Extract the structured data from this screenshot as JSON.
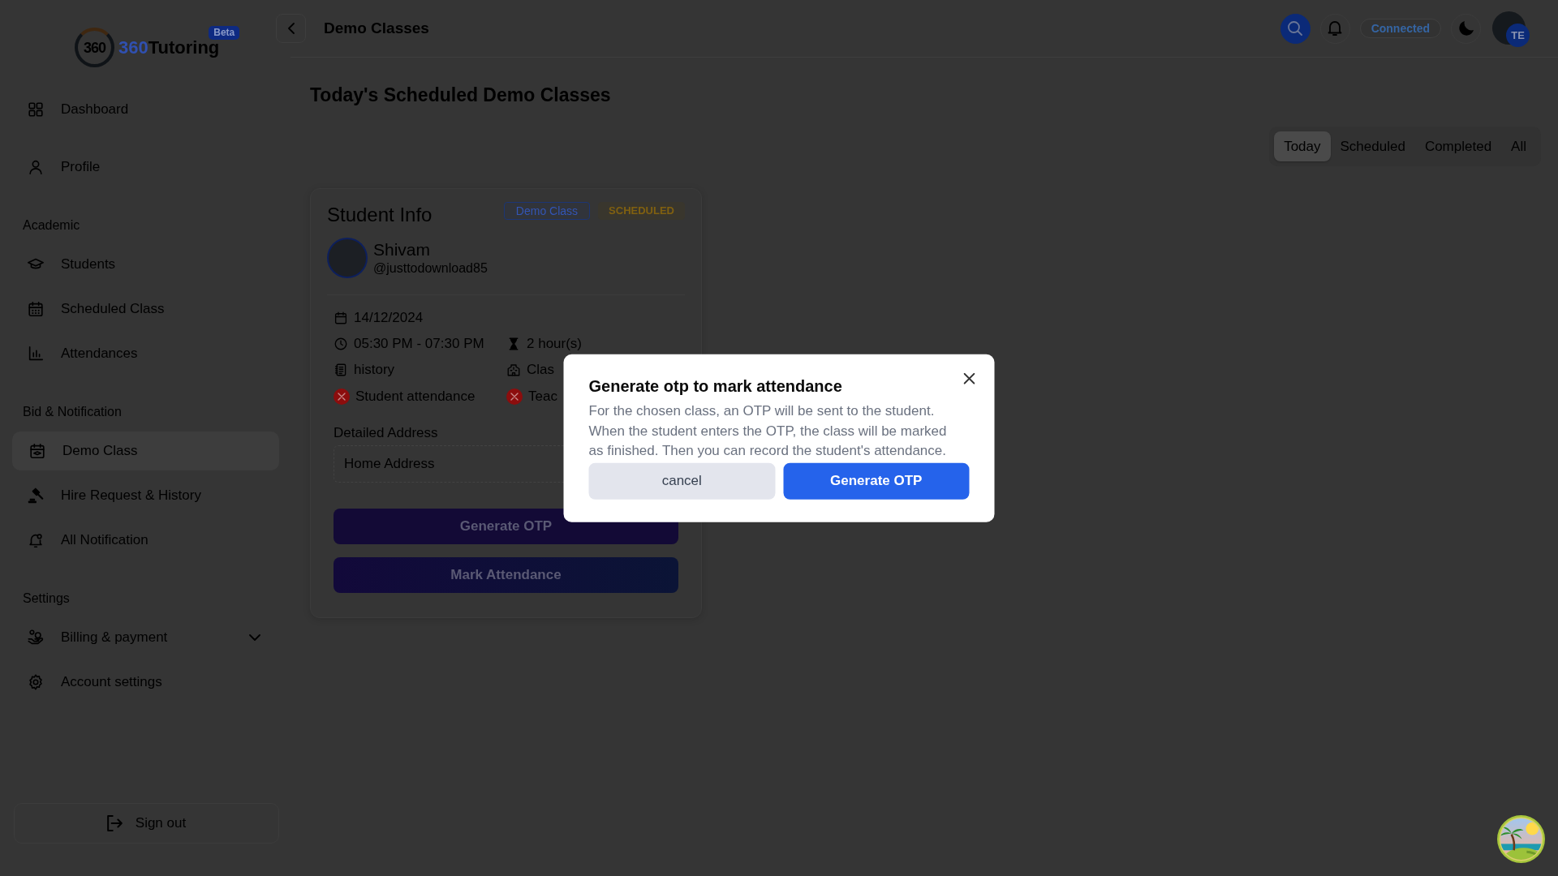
{
  "sidebar": {
    "logo": {
      "emblem": "360",
      "accent": "360",
      "name": "Tutoring",
      "badge": "Beta"
    },
    "sections": [
      {
        "items": [
          {
            "label": "Dashboard",
            "selected": false,
            "kind": "link"
          },
          {
            "label": "Profile",
            "selected": false,
            "kind": "link"
          }
        ]
      },
      {
        "title": "Academic",
        "items": [
          {
            "label": "Students",
            "selected": false,
            "kind": "link"
          },
          {
            "label": "Scheduled Class",
            "selected": false,
            "kind": "link"
          },
          {
            "label": "Attendances",
            "selected": false,
            "kind": "link"
          }
        ]
      },
      {
        "title": "Bid & Notification",
        "items": [
          {
            "label": "Demo Class",
            "selected": true,
            "kind": "link"
          },
          {
            "label": "Hire Request & History",
            "selected": false,
            "kind": "link"
          },
          {
            "label": "All Notification",
            "selected": false,
            "kind": "link"
          }
        ]
      },
      {
        "title": "Settings",
        "items": [
          {
            "label": "Billing & payment",
            "selected": false,
            "kind": "group",
            "expanded": false
          },
          {
            "label": "Account settings",
            "selected": false,
            "kind": "link"
          }
        ]
      }
    ],
    "sign_out": "Sign out"
  },
  "header": {
    "title": "Demo Classes",
    "connection": "Connected",
    "initials": "TE"
  },
  "page": {
    "title": "Today's Scheduled Demo Classes",
    "tabs": [
      {
        "label": "Today",
        "selected": true
      },
      {
        "label": "Scheduled",
        "selected": false
      },
      {
        "label": "Completed",
        "selected": false
      },
      {
        "label": "All",
        "selected": false
      }
    ]
  },
  "card": {
    "title": "Student Info",
    "badges": [
      {
        "label": "Demo Class",
        "kind": "type"
      },
      {
        "label": "SCHEDULED",
        "kind": "status"
      }
    ],
    "student": {
      "name": "Shivam",
      "handle": "@justtodownload85"
    },
    "detail_rows": [
      [
        "14/12/2024"
      ],
      [
        "05:30 PM - 07:30 PM",
        "2 hour(s)"
      ],
      [
        "history",
        "Clas"
      ]
    ],
    "attendance": [
      {
        "label": "Student attendance",
        "marked": false
      },
      {
        "label": "Teac",
        "marked": false
      }
    ],
    "address": {
      "label": "Detailed Address",
      "value": "Home Address"
    },
    "buttons": [
      {
        "label": "Generate OTP"
      },
      {
        "label": "Mark Attendance"
      }
    ]
  },
  "dialog": {
    "title": "Generate otp to mark attendance",
    "message": "For the chosen class, an OTP will be sent to the student. When the student enters the OTP, the class will be marked as finished. Then you can record the student's attendance.",
    "buttons": [
      {
        "label": "cancel",
        "kind": "secondary"
      },
      {
        "label": "Generate OTP",
        "kind": "primary"
      }
    ]
  }
}
